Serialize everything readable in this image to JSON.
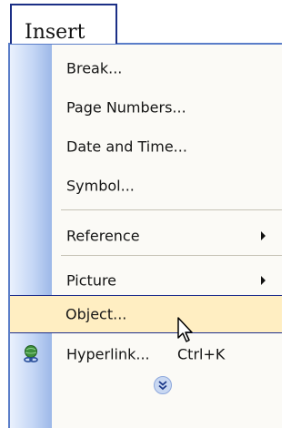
{
  "menu": {
    "title": "Insert",
    "items": [
      {
        "label": "Break..."
      },
      {
        "label": "Page Numbers..."
      },
      {
        "label": "Date and Time..."
      },
      {
        "label": "Symbol..."
      },
      {
        "label": "Reference",
        "submenu": true
      },
      {
        "label": "Picture",
        "submenu": true
      },
      {
        "label": "Object...",
        "state": "highlighted"
      },
      {
        "label": "Hyperlink...",
        "shortcut": "Ctrl+K",
        "icon": "hyperlink-globe-icon"
      }
    ],
    "expand_icon": "double-chevron-down-icon"
  },
  "colors": {
    "highlight_fill": "#ffeec2",
    "highlight_border": "#1e2f8c",
    "gutter": "#c4d6f5"
  }
}
